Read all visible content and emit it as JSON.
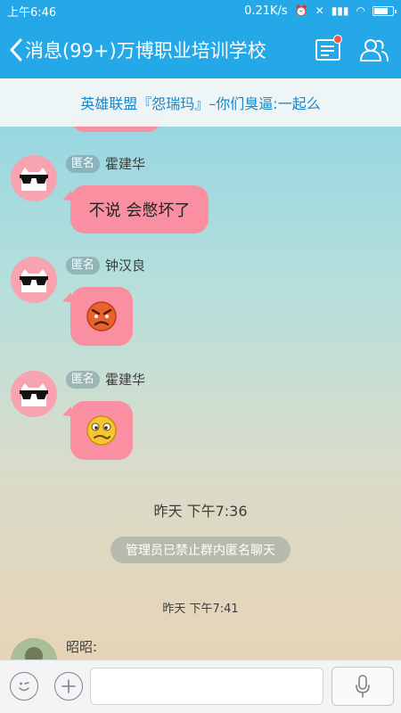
{
  "status_bar": {
    "time": "上午6:46",
    "speed": "0.21K/s",
    "alarm_icon": "alarm-clock-icon",
    "mute_icon": "mute-icon",
    "signal_icon": "signal-icon",
    "wifi_icon": "wifi-icon",
    "battery_icon": "battery-icon"
  },
  "nav": {
    "title": "消息(99+)万博职业培训学校",
    "back_icon": "chevron-left-icon",
    "notice_icon": "notice-board-icon",
    "members_icon": "group-members-icon",
    "has_unread_dot": true
  },
  "banner": {
    "text": "英雄联盟『怨瑞玛』–你们臭逼:一起么"
  },
  "messages": [
    {
      "tag": "匿名",
      "sender": "霍建华",
      "text": "不说 会憋坏了",
      "avatar_icon": "anonymous-cat-sunglasses-avatar"
    },
    {
      "tag": "匿名",
      "sender": "钟汉良",
      "emoji": "angry-face-emoji",
      "avatar_icon": "anonymous-cat-sunglasses-avatar"
    },
    {
      "tag": "匿名",
      "sender": "霍建华",
      "emoji": "confused-face-emoji",
      "avatar_icon": "anonymous-cat-sunglasses-avatar"
    }
  ],
  "time_1": "昨天 下午7:36",
  "system_notice": "管理员已禁止群内匿名聊天",
  "time_2": "昨天 下午7:41",
  "last_message": {
    "sender": "昭昭:"
  },
  "bottom_bar": {
    "emoji_icon": "emoji-face-icon",
    "plus_icon": "plus-icon",
    "input_value": "",
    "mic_icon": "microphone-icon"
  },
  "colors": {
    "accent": "#25a8e8",
    "bubble": "#f98fa0",
    "link": "#1a86c6",
    "unread_dot": "#f2584a"
  }
}
